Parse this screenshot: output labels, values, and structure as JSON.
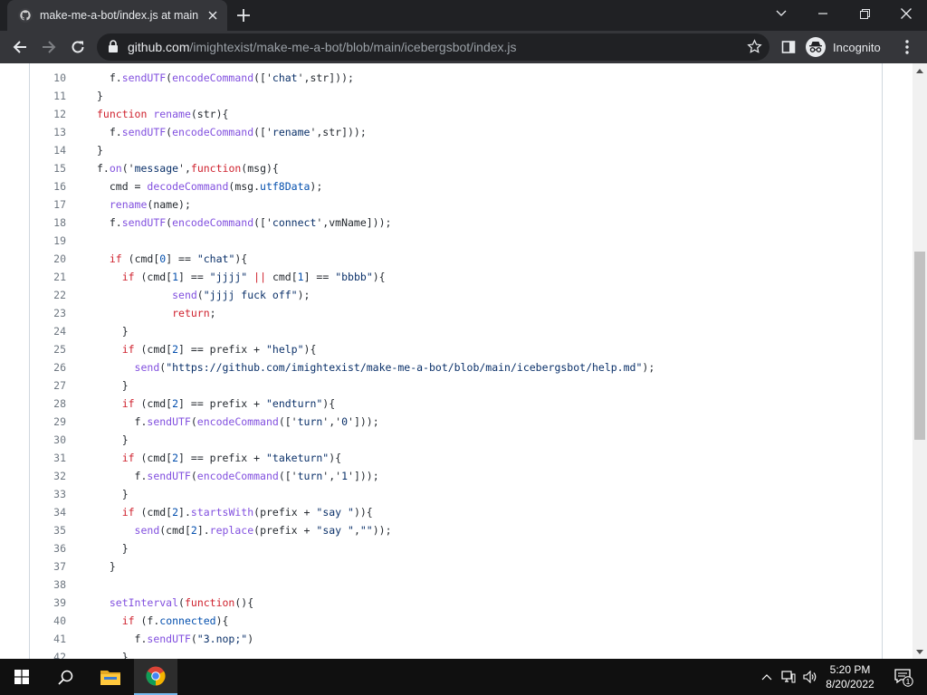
{
  "browser": {
    "tab_title": "make-me-a-bot/index.js at main",
    "url_host": "github.com",
    "url_path": "/imightexist/make-me-a-bot/blob/main/icebergsbot/index.js",
    "profile_label": "Incognito"
  },
  "colors": {
    "keyword": "#cf222e",
    "function": "#8250df",
    "string": "#0a3069",
    "property": "#0550ae",
    "line_number": "#6e7781"
  },
  "code": {
    "lines": [
      {
        "n": "10",
        "tokens": [
          [
            "",
            "  f."
          ],
          [
            "f",
            "sendUTF"
          ],
          [
            "",
            "("
          ],
          [
            "f",
            "encodeCommand"
          ],
          [
            "",
            "(['"
          ],
          [
            "s",
            "chat"
          ],
          [
            "",
            "',str]));"
          ]
        ]
      },
      {
        "n": "11",
        "tokens": [
          [
            "",
            "}"
          ]
        ]
      },
      {
        "n": "12",
        "tokens": [
          [
            "k",
            "function"
          ],
          [
            "",
            " "
          ],
          [
            "f",
            "rename"
          ],
          [
            "",
            "(str){"
          ]
        ]
      },
      {
        "n": "13",
        "tokens": [
          [
            "",
            "  f."
          ],
          [
            "f",
            "sendUTF"
          ],
          [
            "",
            "("
          ],
          [
            "f",
            "encodeCommand"
          ],
          [
            "",
            "(['"
          ],
          [
            "s",
            "rename"
          ],
          [
            "",
            "',str]));"
          ]
        ]
      },
      {
        "n": "14",
        "tokens": [
          [
            "",
            "}"
          ]
        ]
      },
      {
        "n": "15",
        "tokens": [
          [
            "",
            "f."
          ],
          [
            "f",
            "on"
          ],
          [
            "",
            "('"
          ],
          [
            "s",
            "message"
          ],
          [
            "",
            "',"
          ],
          [
            "k",
            "function"
          ],
          [
            "",
            "(msg){"
          ]
        ]
      },
      {
        "n": "16",
        "tokens": [
          [
            "",
            "  cmd = "
          ],
          [
            "f",
            "decodeCommand"
          ],
          [
            "",
            "(msg."
          ],
          [
            "p",
            "utf8Data"
          ],
          [
            "",
            ");"
          ]
        ]
      },
      {
        "n": "17",
        "tokens": [
          [
            "",
            "  "
          ],
          [
            "f",
            "rename"
          ],
          [
            "",
            "(name);"
          ]
        ]
      },
      {
        "n": "18",
        "tokens": [
          [
            "",
            "  f."
          ],
          [
            "f",
            "sendUTF"
          ],
          [
            "",
            "("
          ],
          [
            "f",
            "encodeCommand"
          ],
          [
            "",
            "(['"
          ],
          [
            "s",
            "connect"
          ],
          [
            "",
            "',vmName]));"
          ]
        ]
      },
      {
        "n": "19",
        "tokens": [
          [
            "",
            ""
          ]
        ]
      },
      {
        "n": "20",
        "tokens": [
          [
            "",
            "  "
          ],
          [
            "k",
            "if"
          ],
          [
            "",
            " (cmd["
          ],
          [
            "p",
            "0"
          ],
          [
            "",
            "] == "
          ],
          [
            "s",
            "\"chat\""
          ],
          [
            "",
            "){"
          ]
        ]
      },
      {
        "n": "21",
        "tokens": [
          [
            "",
            "    "
          ],
          [
            "k",
            "if"
          ],
          [
            "",
            " (cmd["
          ],
          [
            "p",
            "1"
          ],
          [
            "",
            "] == "
          ],
          [
            "s",
            "\"jjjj\""
          ],
          [
            "",
            " "
          ],
          [
            "k",
            "||"
          ],
          [
            "",
            " cmd["
          ],
          [
            "p",
            "1"
          ],
          [
            "",
            "] == "
          ],
          [
            "s",
            "\"bbbb\""
          ],
          [
            "",
            "){"
          ]
        ]
      },
      {
        "n": "22",
        "tokens": [
          [
            "",
            "            "
          ],
          [
            "f",
            "send"
          ],
          [
            "",
            "("
          ],
          [
            "s",
            "\"jjjj fuck off\""
          ],
          [
            "",
            ");"
          ]
        ]
      },
      {
        "n": "23",
        "tokens": [
          [
            "",
            "            "
          ],
          [
            "k",
            "return"
          ],
          [
            "",
            ";"
          ]
        ]
      },
      {
        "n": "24",
        "tokens": [
          [
            "",
            "    }"
          ]
        ]
      },
      {
        "n": "25",
        "tokens": [
          [
            "",
            "    "
          ],
          [
            "k",
            "if"
          ],
          [
            "",
            " (cmd["
          ],
          [
            "p",
            "2"
          ],
          [
            "",
            "] == prefix + "
          ],
          [
            "s",
            "\"help\""
          ],
          [
            "",
            "){"
          ]
        ]
      },
      {
        "n": "26",
        "tokens": [
          [
            "",
            "      "
          ],
          [
            "f",
            "send"
          ],
          [
            "",
            "("
          ],
          [
            "s",
            "\"https://github.com/imightexist/make-me-a-bot/blob/main/icebergsbot/help.md\""
          ],
          [
            "",
            ");"
          ]
        ]
      },
      {
        "n": "27",
        "tokens": [
          [
            "",
            "    }"
          ]
        ]
      },
      {
        "n": "28",
        "tokens": [
          [
            "",
            "    "
          ],
          [
            "k",
            "if"
          ],
          [
            "",
            " (cmd["
          ],
          [
            "p",
            "2"
          ],
          [
            "",
            "] == prefix + "
          ],
          [
            "s",
            "\"endturn\""
          ],
          [
            "",
            "){"
          ]
        ]
      },
      {
        "n": "29",
        "tokens": [
          [
            "",
            "      f."
          ],
          [
            "f",
            "sendUTF"
          ],
          [
            "",
            "("
          ],
          [
            "f",
            "encodeCommand"
          ],
          [
            "",
            "(['"
          ],
          [
            "s",
            "turn"
          ],
          [
            "",
            "','"
          ],
          [
            "s",
            "0"
          ],
          [
            "",
            "']));"
          ]
        ]
      },
      {
        "n": "30",
        "tokens": [
          [
            "",
            "    }"
          ]
        ]
      },
      {
        "n": "31",
        "tokens": [
          [
            "",
            "    "
          ],
          [
            "k",
            "if"
          ],
          [
            "",
            " (cmd["
          ],
          [
            "p",
            "2"
          ],
          [
            "",
            "] == prefix + "
          ],
          [
            "s",
            "\"taketurn\""
          ],
          [
            "",
            "){"
          ]
        ]
      },
      {
        "n": "32",
        "tokens": [
          [
            "",
            "      f."
          ],
          [
            "f",
            "sendUTF"
          ],
          [
            "",
            "("
          ],
          [
            "f",
            "encodeCommand"
          ],
          [
            "",
            "(['"
          ],
          [
            "s",
            "turn"
          ],
          [
            "",
            "','"
          ],
          [
            "s",
            "1"
          ],
          [
            "",
            "']));"
          ]
        ]
      },
      {
        "n": "33",
        "tokens": [
          [
            "",
            "    }"
          ]
        ]
      },
      {
        "n": "34",
        "tokens": [
          [
            "",
            "    "
          ],
          [
            "k",
            "if"
          ],
          [
            "",
            " (cmd["
          ],
          [
            "p",
            "2"
          ],
          [
            "",
            "]."
          ],
          [
            "f",
            "startsWith"
          ],
          [
            "",
            "(prefix + "
          ],
          [
            "s",
            "\"say \""
          ],
          [
            "",
            ")){"
          ]
        ]
      },
      {
        "n": "35",
        "tokens": [
          [
            "",
            "      "
          ],
          [
            "f",
            "send"
          ],
          [
            "",
            "(cmd["
          ],
          [
            "p",
            "2"
          ],
          [
            "",
            "]."
          ],
          [
            "f",
            "replace"
          ],
          [
            "",
            "(prefix + "
          ],
          [
            "s",
            "\"say \""
          ],
          [
            "",
            ","
          ],
          [
            "s",
            "\"\""
          ],
          [
            "",
            "));"
          ]
        ]
      },
      {
        "n": "36",
        "tokens": [
          [
            "",
            "    }"
          ]
        ]
      },
      {
        "n": "37",
        "tokens": [
          [
            "",
            "  }"
          ]
        ]
      },
      {
        "n": "38",
        "tokens": [
          [
            "",
            ""
          ]
        ]
      },
      {
        "n": "39",
        "tokens": [
          [
            "",
            "  "
          ],
          [
            "f",
            "setInterval"
          ],
          [
            "",
            "("
          ],
          [
            "k",
            "function"
          ],
          [
            "",
            "(){"
          ]
        ]
      },
      {
        "n": "40",
        "tokens": [
          [
            "",
            "    "
          ],
          [
            "k",
            "if"
          ],
          [
            "",
            " (f."
          ],
          [
            "p",
            "connected"
          ],
          [
            "",
            "){"
          ]
        ]
      },
      {
        "n": "41",
        "tokens": [
          [
            "",
            "      f."
          ],
          [
            "f",
            "sendUTF"
          ],
          [
            "",
            "("
          ],
          [
            "s",
            "\"3.nop;\""
          ],
          [
            "",
            ")"
          ]
        ]
      },
      {
        "n": "42",
        "tokens": [
          [
            "",
            "    }"
          ]
        ]
      }
    ]
  },
  "taskbar": {
    "time": "5:20 PM",
    "date": "8/20/2022",
    "notification_count": "1"
  }
}
